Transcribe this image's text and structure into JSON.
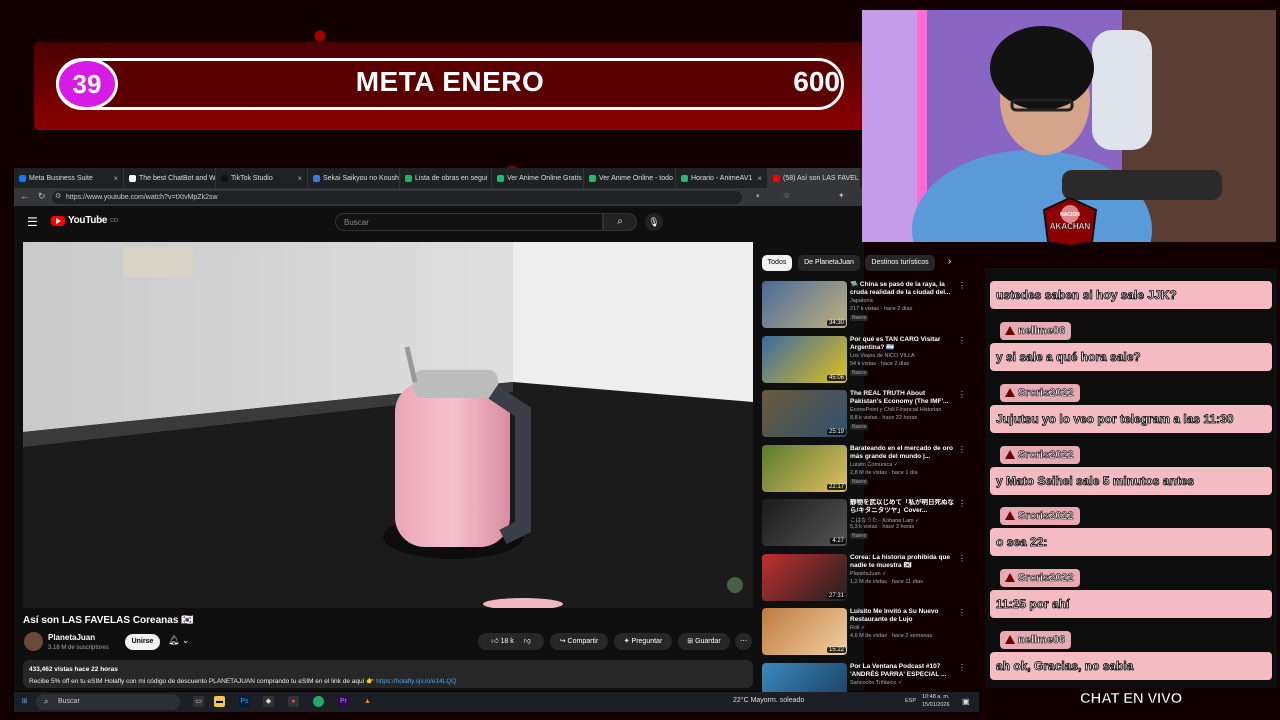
{
  "goal": {
    "current": "39",
    "title": "META ENERO",
    "target": "600"
  },
  "browser": {
    "tabs": [
      {
        "label": "Meta Business Suite",
        "color": "#1877f2"
      },
      {
        "label": "The best ChatBot and W",
        "color": "#ffffff"
      },
      {
        "label": "TikTok Studio",
        "color": "#111111"
      },
      {
        "label": "Sekai Saikyou no Koushi",
        "color": "#3a7bd5"
      },
      {
        "label": "Lista de obras en segui",
        "color": "#27ae60"
      },
      {
        "label": "Ver Anime Online Gratis",
        "color": "#2bb673"
      },
      {
        "label": "Ver Anime Online - todo",
        "color": "#2bb673"
      },
      {
        "label": "Horario - AnimeAV1",
        "color": "#2bb673"
      },
      {
        "label": "(58) Así son LAS FAVEL",
        "color": "#ff0000"
      }
    ],
    "url": "https://www.youtube.com/watch?v=tXtvMpZk2sw"
  },
  "youtube": {
    "logo": "YouTube",
    "logo_country": "CO",
    "search_placeholder": "Buscar",
    "video_title": "Así son LAS FAVELAS Coreanas 🇰🇷",
    "channel": "PlanetaJuan",
    "subscribers": "3.18 M de suscriptores",
    "join": "Unirse",
    "likes": "18 k",
    "share": "Compartir",
    "ask": "Preguntar",
    "save": "Guardar",
    "description_meta": "433,462 vistas  hace 22 horas",
    "description_text": "Recibe 5% off en tu eSIM Holafly con mi código de descuento PLANETAJUAN comprando tu eSIM en el link de aquí 👉",
    "description_link": "https://holafly.sjv.io/e14LQQ",
    "chips": [
      "Todos",
      "De PlanetaJuan",
      "Destinos turísticos"
    ],
    "recommended": [
      {
        "title": "🛸 China se pasó de la raya, la cruda realidad de la ciudad del...",
        "channel": "Japatonic",
        "meta": "217 k vistas · hace 2 días",
        "badge": "Nuevo",
        "duration": "34:30",
        "c1": "#4a6a9a",
        "c2": "#c0b080"
      },
      {
        "title": "Por qué es TAN CARO Visitar Argentina? 🇦🇷",
        "channel": "Los Viajes de NICO VILLA",
        "meta": "54 k vistas · hace 2 días",
        "badge": "Nuevo",
        "duration": "45:06",
        "c1": "#3a6aa0",
        "c2": "#e0c020"
      },
      {
        "title": "The REAL TRUTH About Pakistan's Economy (The IMF'...",
        "channel": "EconoPoint y Chill Financial Historian",
        "meta": "8,8 k vistas · hace 22 horas",
        "badge": "Nuevo",
        "duration": "25:19",
        "c1": "#6a5a3a",
        "c2": "#305070"
      },
      {
        "title": "Barateando en el mercado de oro más grande del mundo |...",
        "channel": "Luisito Comunica ✓",
        "meta": "2,8 M de vistas · hace 1 día",
        "badge": "Nuevo",
        "duration": "22:17",
        "c1": "#5a7a30",
        "c2": "#e0c060"
      },
      {
        "title": "静物を武以じめて「私が明日死ぬなら/キタニタツヤ」Cover...",
        "channel": "こはなうた - Kohana Lam ✓",
        "meta": "5,3 k vistas · hace 3 horas",
        "badge": "Nuevo",
        "duration": "4:27",
        "c1": "#1a1a1a",
        "c2": "#555555"
      },
      {
        "title": "Corea: La historia prohibida que nadie te muestra 🇰🇷",
        "channel": "PlanetaJuan ✓",
        "meta": "1,2 M de vistas · hace 11 días",
        "badge": "",
        "duration": "27:31",
        "c1": "#c03030",
        "c2": "#202020"
      },
      {
        "title": "Luisito Me Invitó a Su Nuevo Restaurante de Lujo",
        "channel": "Roll ✓",
        "meta": "4,6 M de vistas · hace 2 semanas",
        "badge": "",
        "duration": "15:22",
        "c1": "#c07a40",
        "c2": "#f0d0a0"
      },
      {
        "title": "Por La Ventana Podcast #107 'ANDRÉS PARRA' ESPECIAL ...",
        "channel": "Sancocho Trifásico ✓",
        "meta": "",
        "badge": "",
        "duration": "",
        "c1": "#3a8ac0",
        "c2": "#1a3a5a"
      }
    ]
  },
  "chat": {
    "top_message": "ustedes saben si hoy sale JJK?",
    "entries": [
      {
        "author": "nellme06",
        "message": "y si sale a qué hora sale?"
      },
      {
        "author": "Srcris2022",
        "message": "Jujutsu yo lo veo por telegram a las 11:30"
      },
      {
        "author": "Srcris2022",
        "message": "y Mato Seihei sale 5 minutos antes"
      },
      {
        "author": "Srcris2022",
        "message": "o sea 22:"
      },
      {
        "author": "Srcris2022",
        "message": "11:25 por ahí"
      },
      {
        "author": "nellme06",
        "message": "ah ok, Gracias, no sabia"
      }
    ],
    "label": "CHAT EN VIVO"
  },
  "cam": {
    "logo_text": "AKACHAN",
    "logo_sub": "NACION"
  },
  "taskbar": {
    "search": "Buscar",
    "weather": "22°C  Mayorm. soleado",
    "lang": "ESP",
    "time": "10:48 a. m.",
    "date": "15/01/2026"
  }
}
